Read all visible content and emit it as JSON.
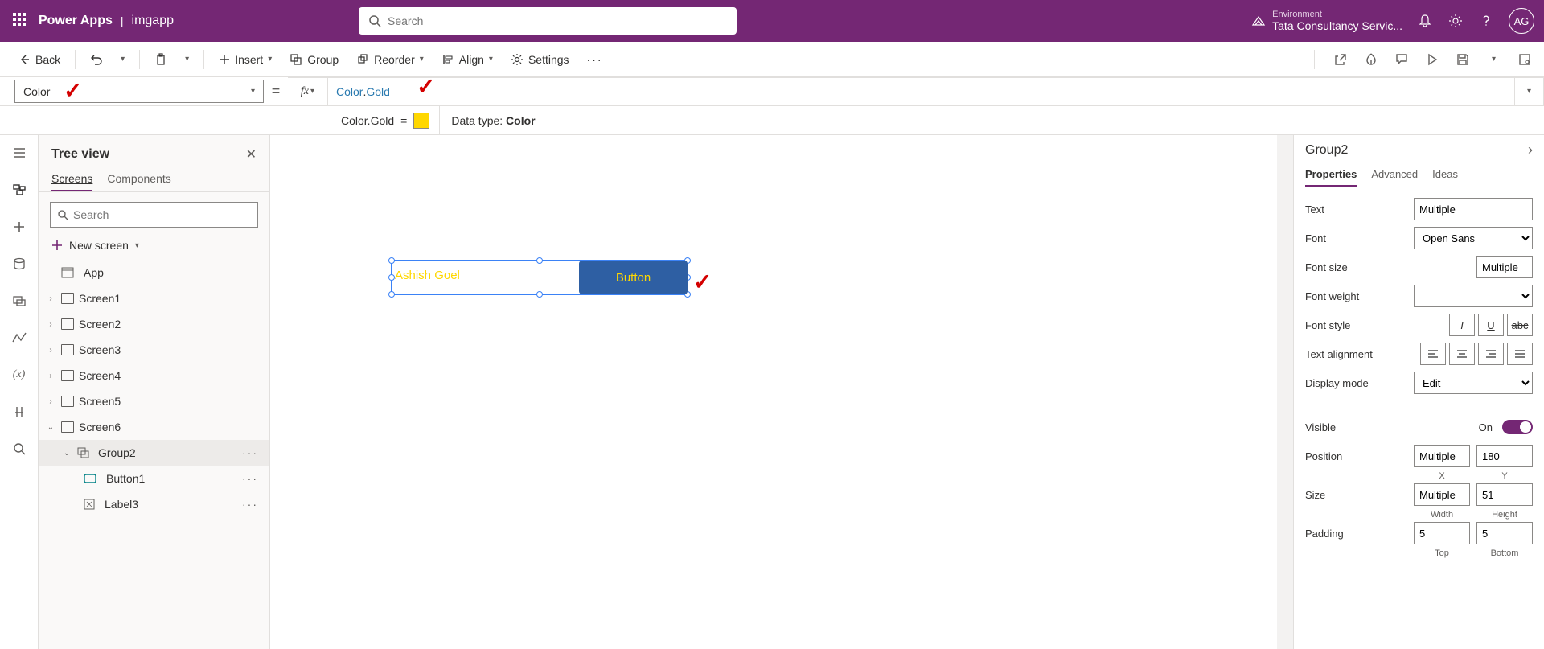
{
  "header": {
    "product": "Power Apps",
    "app_name": "imgapp",
    "search_placeholder": "Search",
    "env_label": "Environment",
    "env_value": "Tata Consultancy Servic...",
    "avatar": "AG"
  },
  "cmdbar": {
    "back": "Back",
    "insert": "Insert",
    "group": "Group",
    "reorder": "Reorder",
    "align": "Align",
    "settings": "Settings"
  },
  "formula": {
    "property": "Color",
    "fx": "fx",
    "token1": "Color",
    "token2": "Gold",
    "info_left": "Color.Gold",
    "datatype_label": "Data type: ",
    "datatype_value": "Color"
  },
  "tree": {
    "title": "Tree view",
    "tab_screens": "Screens",
    "tab_components": "Components",
    "search_placeholder": "Search",
    "new_screen": "New screen",
    "app": "App",
    "screens": [
      "Screen1",
      "Screen2",
      "Screen3",
      "Screen4",
      "Screen5",
      "Screen6"
    ],
    "group": "Group2",
    "children": [
      "Button1",
      "Label3"
    ]
  },
  "canvas": {
    "label_text": "Ashish Goel",
    "button_text": "Button"
  },
  "props": {
    "selection": "Group2",
    "tab_properties": "Properties",
    "tab_advanced": "Advanced",
    "tab_ideas": "Ideas",
    "text_label": "Text",
    "text_value": "Multiple",
    "font_label": "Font",
    "font_value": "Open Sans",
    "fontsize_label": "Font size",
    "fontsize_value": "Multiple",
    "fontweight_label": "Font weight",
    "fontstyle_label": "Font style",
    "textalign_label": "Text alignment",
    "displaymode_label": "Display mode",
    "displaymode_value": "Edit",
    "visible_label": "Visible",
    "visible_value": "On",
    "position_label": "Position",
    "position_x": "Multiple",
    "position_y": "180",
    "x_lab": "X",
    "y_lab": "Y",
    "size_label": "Size",
    "size_w": "Multiple",
    "size_h": "51",
    "w_lab": "Width",
    "h_lab": "Height",
    "padding_label": "Padding",
    "pad_t": "5",
    "pad_b": "5",
    "t_lab": "Top",
    "b_lab": "Bottom"
  }
}
